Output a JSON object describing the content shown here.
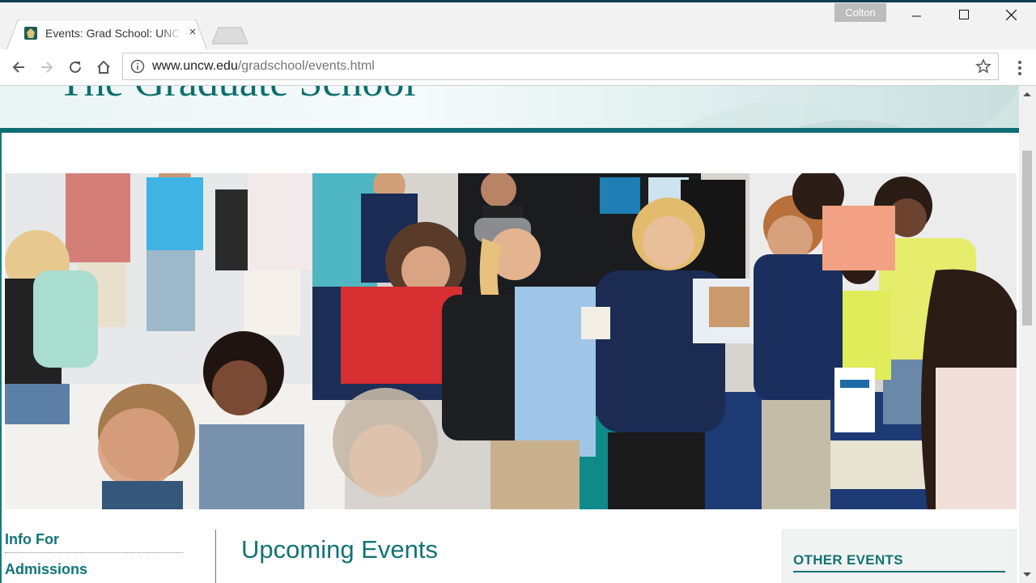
{
  "browser": {
    "tab_title": "Events: Grad School: UNCW",
    "tab_close": "×",
    "profile_name": "Colton",
    "url_domain": "www.uncw.edu",
    "url_path": "/gradschool/events.html"
  },
  "page": {
    "banner_title": "The Graduate School",
    "sidebar": {
      "info_for": "Info For",
      "admissions": "Admissions"
    },
    "main_heading": "Upcoming Events",
    "other_events_heading": "OTHER EVENTS"
  },
  "colors": {
    "brand_teal": "#127374",
    "banner_rule": "#0f6e73"
  }
}
